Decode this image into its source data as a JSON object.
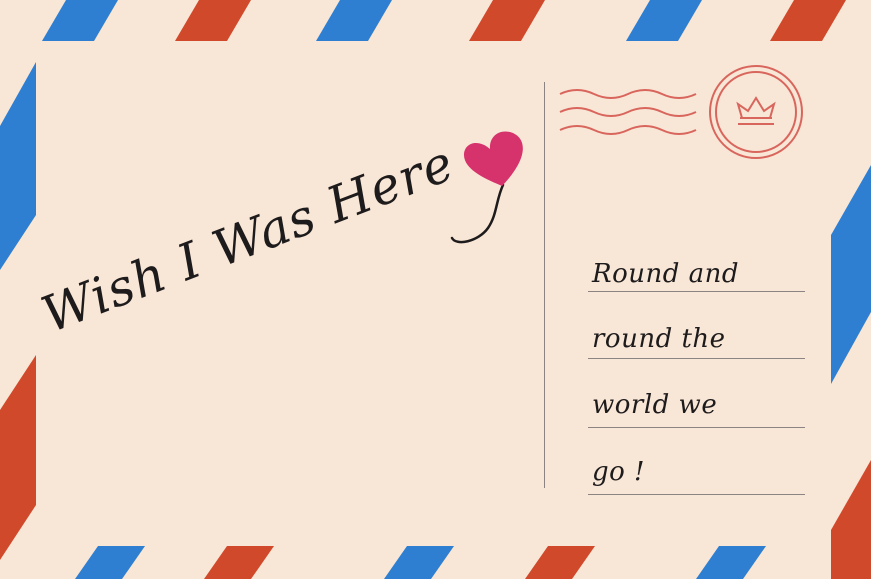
{
  "headline": "Wish I Was Here",
  "message_lines": [
    "Round and",
    "round the",
    "world we",
    "go !"
  ],
  "colors": {
    "background": "#f8e6d6",
    "stripe_blue": "#2e7fd1",
    "stripe_red": "#d1492b",
    "ink": "#1e1b1c",
    "heart": "#d6336c",
    "postmark": "#d9665d",
    "rule": "#8c8482"
  },
  "icons": [
    "heart-icon",
    "postmark-stamp-icon",
    "crown-icon",
    "postmark-wavy-lines-icon"
  ]
}
